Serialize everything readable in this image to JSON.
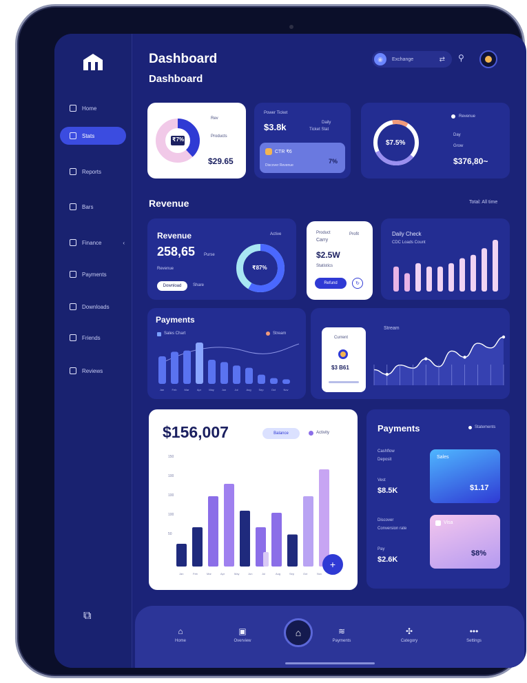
{
  "header": {
    "title": "Dashboard",
    "subtitle": "Dashboard"
  },
  "sidebar": {
    "items": [
      {
        "label": "Home",
        "icon": "home-icon",
        "active": false
      },
      {
        "label": "Stats",
        "icon": "stats-icon",
        "active": true
      },
      {
        "label": "Reports",
        "icon": "folder-icon",
        "active": false
      },
      {
        "label": "Bars",
        "icon": "bar-chart-icon",
        "active": false
      },
      {
        "label": "Finance",
        "icon": "clock-icon",
        "active": false
      },
      {
        "label": "Payments",
        "icon": "card-icon",
        "active": false
      },
      {
        "label": "Downloads",
        "icon": "download-icon",
        "active": false
      },
      {
        "label": "Friends",
        "icon": "people-icon",
        "active": false
      },
      {
        "label": "Reviews",
        "icon": "review-icon",
        "active": false
      }
    ]
  },
  "topbar": {
    "pill_label": "Exchange",
    "pill_extra": "⇄"
  },
  "cards": {
    "c1": {
      "small_top": "Rev",
      "sub_label": "Products",
      "value": "$29.65",
      "donut_label": "₹7%"
    },
    "c2": {
      "head": "Power Ticket",
      "value": "$3.8k",
      "mid_small": "Daily",
      "mid_right": "Ticket Stat",
      "chip": "CTR ₹6",
      "chip_pct": "7%",
      "footer": "Discover Revenue"
    },
    "c3": {
      "legend": "Revenue",
      "small1": "Day",
      "small2": "Grow",
      "value": "$376,80~",
      "ring": "$7.5%"
    }
  },
  "revenue_section": {
    "title": "Revenue",
    "link": "Total: All time"
  },
  "rev": {
    "label": "Revenue",
    "badge": "Active",
    "value": "258,65",
    "unit": "Purse",
    "sub": "Revenue",
    "btn": "Download",
    "btn2": "Share",
    "ring": "₹87%"
  },
  "mini_card": {
    "h1": "Product",
    "h2": "Carry",
    "badge": "Profit",
    "value": "$2.5W",
    "sub": "Statistics",
    "btn": "Refund"
  },
  "bars_card": {
    "title": "Daily Check",
    "sub": "CDC Loads Count",
    "values": [
      30,
      22,
      34,
      30,
      30,
      34,
      40,
      44,
      52,
      62
    ]
  },
  "payments_card": {
    "title": "Payments",
    "legend1": "Sales Chart",
    "legend2": "Stream",
    "values": [
      48,
      56,
      58,
      72,
      42,
      38,
      32,
      28,
      16,
      10,
      8
    ],
    "ticks": [
      "Jan",
      "Feb",
      "Mar",
      "Apr",
      "May",
      "Jun",
      "Jul",
      "Aug",
      "Sep",
      "Oct",
      "Nov"
    ]
  },
  "stream_card": {
    "label": "Stream",
    "inner_title": "Current",
    "inner_value": "$3 B61",
    "values": [
      20,
      14,
      26,
      22,
      34,
      24,
      44,
      36,
      54,
      48,
      62
    ]
  },
  "main_chart": {
    "value": "$156,007",
    "pill1": "Balance",
    "pill2": "Activity",
    "yticks": [
      "150",
      "100",
      "100",
      "100",
      "50"
    ],
    "xticks": [
      "Jan",
      "Feb",
      "Mar",
      "Apr",
      "May",
      "Jun",
      "Jul",
      "Aug",
      "Sep",
      "Oct",
      "Nov",
      "Dec"
    ],
    "fab": "+"
  },
  "chart_data": {
    "type": "bar",
    "categories": [
      "1",
      "2",
      "3",
      "4",
      "5",
      "6",
      "7",
      "8",
      "9",
      "10",
      "11"
    ],
    "series": [
      {
        "values": [
          22,
          38,
          68,
          80,
          54,
          38,
          52,
          31,
          68,
          94,
          0
        ]
      },
      {
        "values": [
          0,
          0,
          0,
          0,
          0,
          0,
          14,
          0,
          0,
          0,
          0
        ]
      }
    ],
    "ylim": [
      0,
      100
    ]
  },
  "payments_panel": {
    "title": "Payments",
    "legend": "Statements",
    "r1a": "Cashflow",
    "r1b": "Deposit",
    "r1c": "Vest",
    "r1v": "$8.5K",
    "card1_label": "Sales",
    "card1_value": "$1.17",
    "r2a": "Discover",
    "r2b": "Conversion rate",
    "r2c": "Pay",
    "r2v": "$2.6K",
    "card2_label": "Visa",
    "card2_value": "$8%"
  },
  "bottom_nav": [
    {
      "label": "Home",
      "glyph": "⌂"
    },
    {
      "label": "Overview",
      "glyph": "▣"
    },
    {
      "label": "Payments",
      "glyph": "≋"
    },
    {
      "label": "Category",
      "glyph": "✣"
    },
    {
      "label": "Settings",
      "glyph": "•••"
    }
  ],
  "colors": {
    "screen": "#1b2378",
    "accent": "#3b4ce0",
    "card_dark": "#232d92",
    "purple": "#8b6ee8",
    "navy_bar": "#1f2a7d"
  }
}
